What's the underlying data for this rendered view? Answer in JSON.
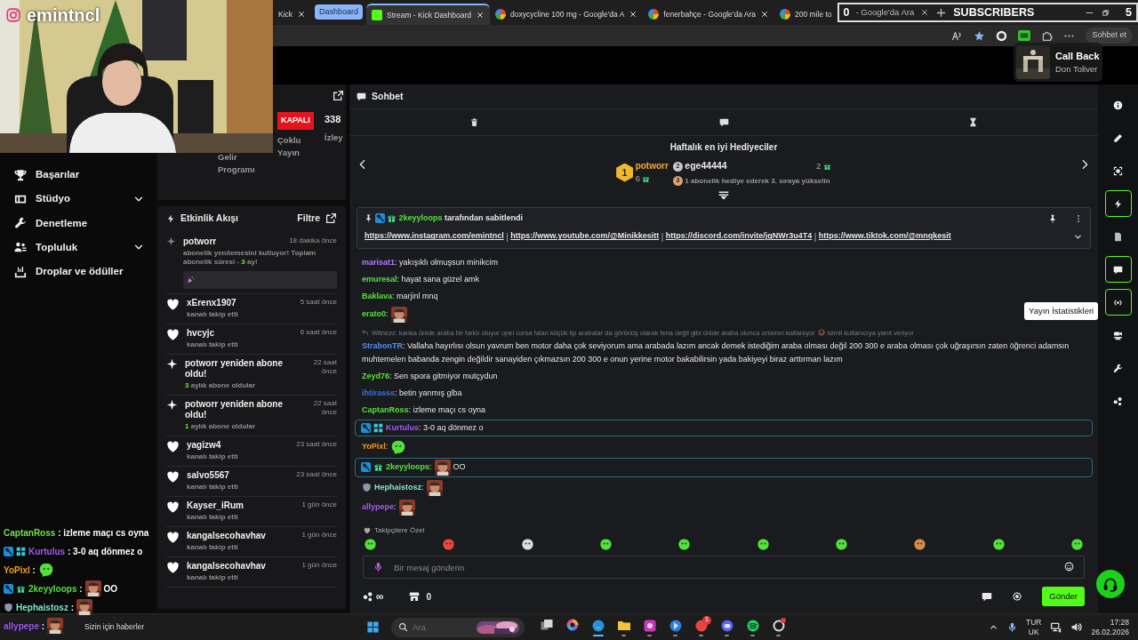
{
  "stream_overlay": {
    "streamer": "emintncl",
    "webcam": {
      "kind": "picture"
    },
    "subscribers_widget": {
      "left_count": "0",
      "tab_tail": "- Google'da Ara",
      "label": "SUBSCRIBERS",
      "right_count": "5"
    },
    "now_playing": {
      "title": "Call Back",
      "artist": "Don Toliver"
    },
    "chat_overlay": [
      {
        "user": "CaptanRoss",
        "color": "#6fe34a",
        "text": " : izleme maçı cs oyna"
      },
      {
        "user": "Kurtulus",
        "color": "#a65cf5",
        "badges": [
          {
            "kind": "moderator"
          },
          {
            "kind": "og"
          }
        ],
        "text": " : 3-0 aq dönmez o"
      },
      {
        "user": "YoPixl",
        "color": "#f0a020",
        "text": " :",
        "emote": {
          "kind": "blob"
        }
      },
      {
        "user": "2keyyloops",
        "color": "#56e03a",
        "badges": [
          {
            "kind": "moderator"
          },
          {
            "kind": "subscriber"
          }
        ],
        "text": " :",
        "emote": {
          "kind": "picture"
        },
        "after": "OO"
      },
      {
        "user": "Hephaistosz",
        "color": "#7fe8c8",
        "badges": [
          {
            "kind": "shield"
          }
        ],
        "text": " :",
        "emote": {
          "kind": "picture"
        }
      },
      {
        "user": "allypepe",
        "color": "#a35cf0",
        "text": " :",
        "emote": {
          "kind": "picture"
        }
      }
    ]
  },
  "browser": {
    "strip": [
      {
        "kind": "tab",
        "title": "Kick",
        "selected": false
      },
      {
        "kind": "group",
        "label": "Dashboard"
      },
      {
        "kind": "tab",
        "title": "Stream - Kick Dashboard",
        "favicon": {
          "kind": "kick"
        },
        "selected": true
      },
      {
        "kind": "tab",
        "title": "doxycycline 100 mg - Google'da A",
        "favicon": {
          "kind": "google"
        },
        "selected": false
      },
      {
        "kind": "tab",
        "title": "fenerbahçe - Google'da Ara",
        "favicon": {
          "kind": "google"
        },
        "selected": false
      },
      {
        "kind": "tab",
        "title": "200 mile to",
        "favicon": {
          "kind": "google"
        },
        "selected": false
      }
    ],
    "copilot_label": "Sohbet et"
  },
  "sidebar": {
    "items": [
      {
        "label": "Başarılar",
        "expandable": false
      },
      {
        "label": "Stüdyo",
        "expandable": true
      },
      {
        "label": "Denetleme",
        "expandable": false
      },
      {
        "label": "Topluluk",
        "expandable": true
      },
      {
        "label": "Droplar ve ödüller",
        "expandable": false
      }
    ]
  },
  "stream_card": {
    "revenue_label": "Gelir Programı",
    "status": "KAPALI",
    "status_label": "Çoklu Yayın",
    "viewers": "338",
    "viewers_label": "İzley"
  },
  "activity": {
    "title": "Etkinlik Akışı",
    "filter": "Filtre",
    "items": [
      {
        "kind": "renewal",
        "user": "potworr",
        "time": "18 dakika önce",
        "text_before": "abonelik yenilemesini kutluyor! Toplam abonelik süresi - ",
        "months": "3",
        "text_after": " ay!"
      },
      {
        "kind": "follow",
        "user": "xErenx1907",
        "time": "5 saat önce",
        "text": "kanalı takip etti"
      },
      {
        "kind": "follow",
        "user": "hvcyjc",
        "time": "6 saat önce",
        "text": "kanalı takip etti"
      },
      {
        "kind": "resub",
        "user": "potworr yeniden abone oldu!",
        "time": "22 saat önce",
        "months": "3",
        "text": "aylık abone oldular"
      },
      {
        "kind": "resub",
        "user": "potworr yeniden abone oldu!",
        "time": "22 saat önce",
        "months": "1",
        "text": "aylık abone oldular"
      },
      {
        "kind": "follow",
        "user": "yagizw4",
        "time": "23 saat önce",
        "text": "kanalı takip etti"
      },
      {
        "kind": "follow",
        "user": "salvo5567",
        "time": "23 saat önce",
        "text": "kanalı takip etti"
      },
      {
        "kind": "follow",
        "user": "Kayser_iRum",
        "time": "1 gün önce",
        "text": "kanalı takip etti"
      },
      {
        "kind": "follow",
        "user": "kangalsecohavhav",
        "time": "1 gün önce",
        "text": "kanalı takip etti"
      },
      {
        "kind": "follow",
        "user": "kangalsecohavhav",
        "time": "1 gün önce",
        "text": "kanalı takip etti"
      }
    ]
  },
  "chat": {
    "title": "Sohbet",
    "leaderboard": {
      "title": "Haftalık en iyi Hediyeciler",
      "top": [
        {
          "rank": "1",
          "name": "potworr",
          "count": "6"
        },
        {
          "rank": "2",
          "name": "ege44444",
          "count": "2"
        }
      ],
      "next": {
        "rank": "3",
        "text": "1 abonelik hediye ederek 3. sıraya yükselin"
      }
    },
    "pinned": {
      "user": "2keyyloops",
      "color": "#56e03a",
      "badges": [
        {
          "kind": "moderator"
        },
        {
          "kind": "subscriber"
        }
      ],
      "text": "tarafından sabitlendi",
      "separator": "|",
      "links": [
        "https://www.instagram.com/emintncl",
        "https://www.youtube.com/@Minikkesitt",
        "https://discord.com/invite/jgNWr3u4T4",
        "https://www.tiktok.com/@mnqkesit"
      ]
    },
    "messages": [
      {
        "user": "marisat1",
        "color": "#b07cff",
        "text": ": yakışıklı olmuşsun minikcim",
        "highlighted": false
      },
      {
        "user": "emuresal",
        "color": "#56e03a",
        "text": ": hayat sana güzel amk",
        "highlighted": false
      },
      {
        "user": "Baklava",
        "color": "#56e03a",
        "text": ": marjinl mnq",
        "highlighted": false
      },
      {
        "user": "erato0",
        "color": "#56e03a",
        "text": ":",
        "emote": {
          "kind": "picture"
        },
        "highlighted": false
      },
      {
        "user": "StrabonTR",
        "color": "#4f8ff7",
        "reply": {
          "text": "Witnezz: kanka ünide araba bir farklı oluyor opel corsa falan küçük tip arabalar da görünüş olarak fena değil gibi ünide araba olunca ortamın katlanıyor",
          "suffix": "isimli kullanıcıya yanıt veriyor"
        },
        "text": ": Vallaha hayırlısı olsun yavrum ben motor daha çok seviyorum ama arabada lazım ancak demek istediğim araba olması değil 200 300 e araba olması çok uğraşırsın zaten öğrenci adamsın muhtemelen babanda zengin değildir sanayiden çıkmazsın 200 300 e onun yerine motor bakabilirsin yada bakiyeyi biraz arttırman lazım",
        "highlighted": false
      },
      {
        "user": "Zeyd76",
        "color": "#56e03a",
        "text": ": Sen spora gitmiyor mutçydun",
        "highlighted": false
      },
      {
        "user": "ihtirasss",
        "color": "#3d6fe0",
        "text": ": betin yanmış glba",
        "highlighted": false
      },
      {
        "user": "CaptanRoss",
        "color": "#56e03a",
        "text": ": izleme maçı cs oyna",
        "highlighted": false
      },
      {
        "user": "Kurtulus",
        "color": "#a65cf5",
        "badges": [
          {
            "kind": "moderator"
          },
          {
            "kind": "og"
          }
        ],
        "text": ": 3-0 aq dönmez o",
        "highlighted": true
      },
      {
        "user": "YoPixl",
        "color": "#f29c1f",
        "text": ":",
        "emote": {
          "kind": "blob"
        },
        "highlighted": false
      },
      {
        "user": "2keyyloops",
        "color": "#56e03a",
        "badges": [
          {
            "kind": "moderator"
          },
          {
            "kind": "subscriber"
          }
        ],
        "text": ":",
        "emote": {
          "kind": "picture"
        },
        "after": "OO",
        "highlighted": true
      },
      {
        "user": "Hephaistosz",
        "color": "#7fe8c8",
        "badges": [
          {
            "kind": "shield"
          }
        ],
        "text": ":",
        "emote": {
          "kind": "picture"
        },
        "highlighted": false
      },
      {
        "user": "allypepe",
        "color": "#a35cf0",
        "text": ":",
        "emote": {
          "kind": "picture"
        },
        "highlighted": false
      }
    ],
    "followers_only": "Takipçilere Özel",
    "input": {
      "placeholder": "Bir mesaj gönderin"
    },
    "points": "∞",
    "store_count": "0",
    "send": "Gönder"
  },
  "rail": [
    {
      "highlighted": false
    },
    {
      "highlighted": false
    },
    {
      "highlighted": false
    },
    {
      "highlighted": true
    },
    {
      "highlighted": false
    },
    {
      "highlighted": true
    },
    {
      "highlighted": true,
      "tooltip": "Yayın İstatistikleri"
    },
    {
      "highlighted": false
    },
    {
      "highlighted": false
    },
    {
      "highlighted": false
    }
  ],
  "taskbar": {
    "news": "Sizin için haberler",
    "search": {
      "placeholder": "Ara"
    },
    "apps": [
      {
        "running": false,
        "active": false
      },
      {
        "running": false,
        "active": false
      },
      {
        "running": true,
        "active": true
      },
      {
        "running": true,
        "active": false
      },
      {
        "running": true,
        "active": false
      },
      {
        "running": true,
        "active": false
      },
      {
        "running": true,
        "active": false,
        "badge": "1"
      },
      {
        "running": true,
        "active": false
      },
      {
        "running": true,
        "active": false
      },
      {
        "running": true,
        "active": false,
        "alert": true
      }
    ],
    "language": "TUR",
    "layout": "UK",
    "time": "17:28",
    "date": "26.02.2026"
  }
}
